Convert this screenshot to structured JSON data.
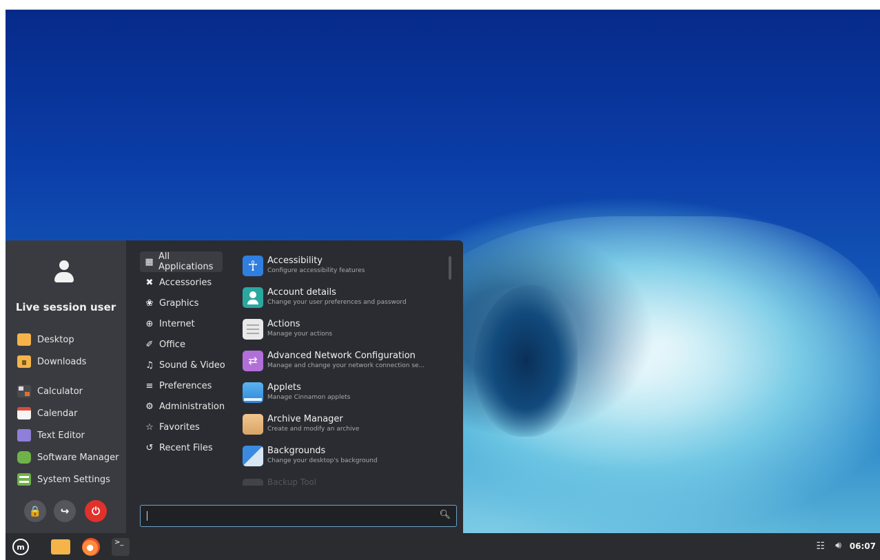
{
  "menu": {
    "username": "Live session user",
    "favorites": [
      {
        "label": "Desktop",
        "icon": "folder-desktop-icon"
      },
      {
        "label": "Downloads",
        "icon": "folder-downloads-icon"
      },
      {
        "label": "Calculator",
        "icon": "calculator-icon"
      },
      {
        "label": "Calendar",
        "icon": "calendar-icon"
      },
      {
        "label": "Text Editor",
        "icon": "text-editor-icon"
      },
      {
        "label": "Software Manager",
        "icon": "software-manager-icon"
      },
      {
        "label": "System Settings",
        "icon": "system-settings-icon"
      }
    ],
    "categories": [
      {
        "label": "All Applications",
        "icon": "grid-icon",
        "active": true
      },
      {
        "label": "Accessories",
        "icon": "tools-icon"
      },
      {
        "label": "Graphics",
        "icon": "palette-icon"
      },
      {
        "label": "Internet",
        "icon": "globe-icon"
      },
      {
        "label": "Office",
        "icon": "paperclip-icon"
      },
      {
        "label": "Sound & Video",
        "icon": "media-icon"
      },
      {
        "label": "Preferences",
        "icon": "sliders-icon"
      },
      {
        "label": "Administration",
        "icon": "gear-icon"
      },
      {
        "label": "Favorites",
        "icon": "star-icon"
      },
      {
        "label": "Recent Files",
        "icon": "history-icon"
      }
    ],
    "apps": [
      {
        "name": "Accessibility",
        "desc": "Configure accessibility features",
        "icon": "accessibility-icon"
      },
      {
        "name": "Account details",
        "desc": "Change your user preferences and password",
        "icon": "account-icon"
      },
      {
        "name": "Actions",
        "desc": "Manage your actions",
        "icon": "actions-icon"
      },
      {
        "name": "Advanced Network Configuration",
        "desc": "Manage and change your network connection se...",
        "icon": "network-config-icon"
      },
      {
        "name": "Applets",
        "desc": "Manage Cinnamon applets",
        "icon": "applets-icon"
      },
      {
        "name": "Archive Manager",
        "desc": "Create and modify an archive",
        "icon": "archive-icon"
      },
      {
        "name": "Backgrounds",
        "desc": "Change your desktop's background",
        "icon": "backgrounds-icon"
      }
    ],
    "partial_app": "Backup Tool",
    "search": {
      "value": "",
      "placeholder": ""
    },
    "session_buttons": [
      "lock-icon",
      "logout-icon",
      "power-icon"
    ]
  },
  "panel": {
    "clock": "06:07",
    "launchers": [
      "menu-icon",
      "files-icon",
      "firefox-icon",
      "terminal-icon"
    ],
    "tray": [
      "network-icon",
      "volume-icon"
    ]
  },
  "colors": {
    "accent": "#6aa2c8",
    "menu_bg": "#2b2c31",
    "sidebar_bg": "#3a3b40",
    "power": "#e0312b"
  }
}
